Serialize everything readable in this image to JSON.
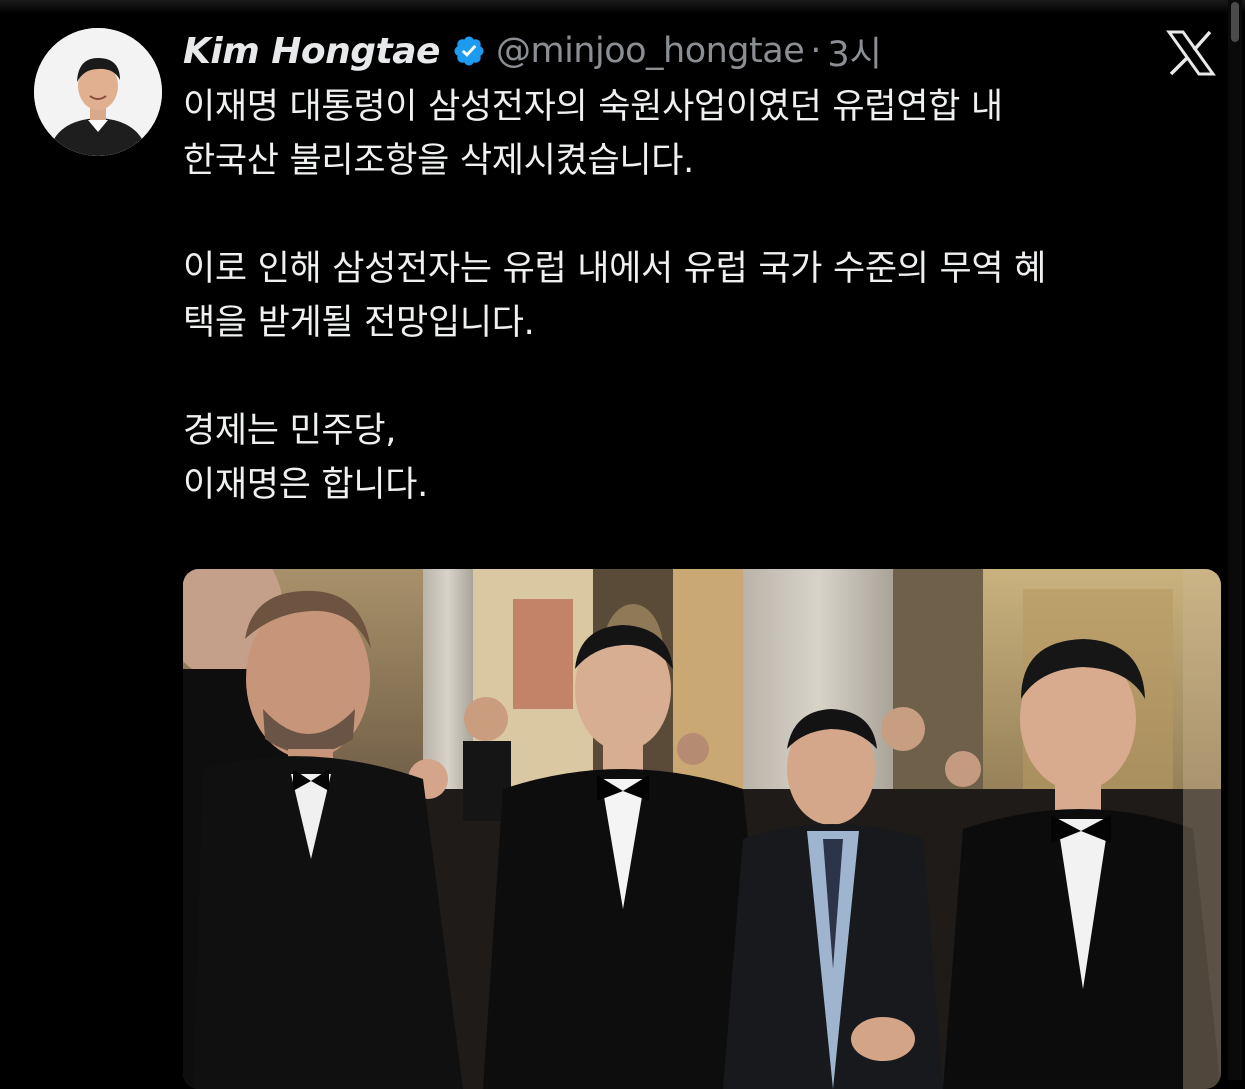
{
  "tweet": {
    "display_name": "Kim Hongtae",
    "handle": "@minjoo_hongtae",
    "separator": "·",
    "time": "3시",
    "lines": [
      "이재명 대통령이 삼성전자의 숙원사업이였던 유럽연합 내",
      "한국산 불리조항을 삭제시켰습니다.",
      "",
      "이로 인해 삼성전자는 유럽 내에서 유럽 국가 수준의 무역 혜",
      "택을 받게될 전망입니다.",
      "",
      "경제는 민주당,",
      "이재명은 합니다."
    ]
  },
  "icons": {
    "verified": "verified-badge-icon",
    "platform": "x-logo-icon"
  },
  "colors": {
    "background": "#000000",
    "text": "#e7e9ea",
    "muted": "#8b8f94",
    "verified": "#1d9bf0"
  }
}
